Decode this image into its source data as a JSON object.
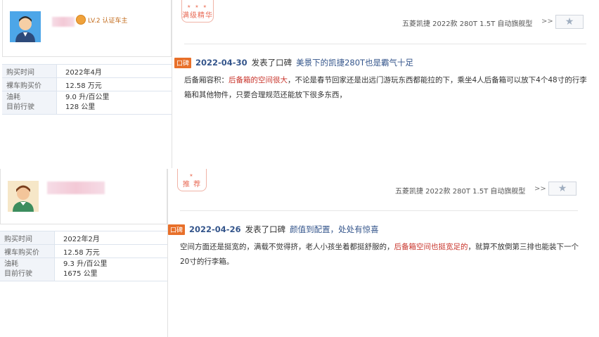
{
  "reviews": [
    {
      "user": {
        "badge": "LV.2 认证车主"
      },
      "stamp": {
        "stars": "★ ★ ★",
        "label": "满级精华"
      },
      "car_model": "五菱凯捷 2022款 280T 1.5T 自动旗舰型",
      "more": ">>",
      "fav_icon": "★",
      "info": {
        "purchase_time_label": "购买时间",
        "purchase_time": "2022年4月",
        "price_label": "裸车购买价",
        "price": "12.58 万元",
        "fuel_label": "油耗",
        "fuel": "9.0 升/百公里",
        "mileage_label": "目前行驶",
        "mileage": "128 公里"
      },
      "tag": "口碑",
      "date": "2022-04-30",
      "action": "发表了口碑",
      "title": "美景下的凯捷280T也是霸气十足",
      "body": {
        "prefix": "后备厢容积：",
        "highlight": "后备箱的空间很大",
        "suffix": "，不论是春节回家还是出远门游玩东西都能拉的下，乘坐4人后备箱可以放下4个48寸的行李箱和其他物件，只要合理规范还能放下很多东西，"
      }
    },
    {
      "user": {
        "badge": ""
      },
      "stamp": {
        "stars": "★",
        "label": "推 荐"
      },
      "car_model": "五菱凯捷 2022款 280T 1.5T 自动旗舰型",
      "more": ">>",
      "fav_icon": "★",
      "info": {
        "purchase_time_label": "购买时间",
        "purchase_time": "2022年2月",
        "price_label": "裸车购买价",
        "price": "12.58 万元",
        "fuel_label": "油耗",
        "fuel": "9.3 升/百公里",
        "mileage_label": "目前行驶",
        "mileage": "1675 公里"
      },
      "tag": "口碑",
      "date": "2022-04-26",
      "action": "发表了口碑",
      "title": "颜值到配置，处处有惊喜",
      "body": {
        "prefix": "空间方面还是挺宽的，满载不觉得挤，老人小孩坐着都挺舒服的，",
        "highlight": "后备箱空间也挺宽足的",
        "suffix": "，就算不放倒第三排也能装下一个20寸的行李箱。"
      }
    }
  ]
}
